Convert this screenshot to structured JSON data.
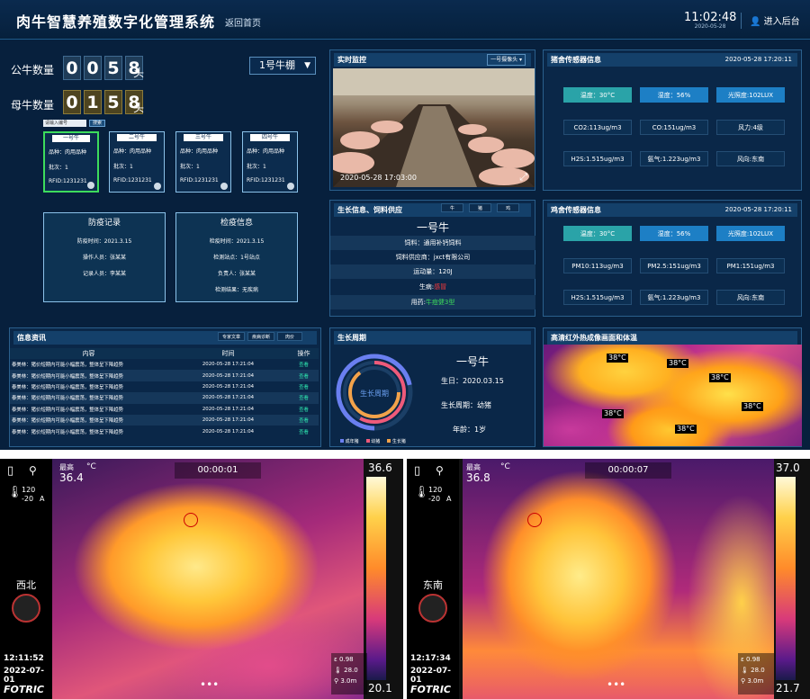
{
  "header": {
    "title": "肉牛智慧养殖数字化管理系统",
    "back": "返回首页",
    "time": "11:02:48",
    "date": "2020-05-28",
    "login": "进入后台"
  },
  "counts": {
    "bull_label": "公牛数量",
    "bull_digits": [
      "0",
      "0",
      "5",
      "8"
    ],
    "cow_label": "母牛数量",
    "cow_digits": [
      "0",
      "1",
      "5",
      "8"
    ],
    "unit": "头",
    "shed": "1号牛棚"
  },
  "search": {
    "placeholder": "请输入编号",
    "button": "搜索"
  },
  "cattle": [
    {
      "name": "一号牛",
      "breed": "品种：肉用品种",
      "batch": "批次：1",
      "rfid": "RFID:1231231"
    },
    {
      "name": "二号牛",
      "breed": "品种：肉用品种",
      "batch": "批次：1",
      "rfid": "RFID:1231231"
    },
    {
      "name": "三号牛",
      "breed": "品种：肉用品种",
      "batch": "批次：1",
      "rfid": "RFID:1231231"
    },
    {
      "name": "四号牛",
      "breed": "品种：肉用品种",
      "batch": "批次：1",
      "rfid": "RFID:1231231"
    }
  ],
  "epidemic": {
    "title": "防疫记录",
    "time": "防疫时间：2021.3.15",
    "operator": "操作人员：张某某",
    "recorder": "记录人员：李某某"
  },
  "quarantine": {
    "title": "检疫信息",
    "time": "检疫时间：2021.3.15",
    "site": "检测站点：1号站点",
    "lead": "负责人：张某某",
    "result": "检测结果：无疾病"
  },
  "monitor": {
    "title": "实时监控",
    "camera": "一号摄像头",
    "timestamp": "2020-05-28  17:03:00"
  },
  "pig_sensors": {
    "title": "猪舍传感器信息",
    "time": "2020-05-28 17:20:11",
    "items": [
      "温度：30°C",
      "湿度：56%",
      "光照度:102LUX",
      "CO2:113ug/m3",
      "CO:151ug/m3",
      "风力:4级",
      "H2S:1.515ug/m3",
      "氨气:1.223ug/m3",
      "风向:东南"
    ]
  },
  "chicken_sensors": {
    "title": "鸡舍传感器信息",
    "time": "2020-05-28 17:20:11",
    "items": [
      "温度：30°C",
      "湿度：56%",
      "光照度:102LUX",
      "PM10:113ug/m3",
      "PM2.5:151ug/m3",
      "PM1:151ug/m3",
      "H2S:1.515ug/m3",
      "氨气:1.223ug/m3",
      "风向:东南"
    ]
  },
  "growth": {
    "title": "生长信息、饲料供应",
    "tabs": [
      "牛",
      "猪",
      "鸡"
    ],
    "name": "一号牛",
    "feed": "饲料：通用补钙饲料",
    "supplier": "饲料供应商：jxct有限公司",
    "exercise": "运动量：120J",
    "disease_label": "生病:",
    "disease": "感冒",
    "med_label": "用药:",
    "med": "牛痘健3型"
  },
  "news": {
    "title": "信息资讯",
    "tabs": [
      "专家文章",
      "疾病诊断",
      "肉价"
    ],
    "cols": [
      "内容",
      "时间",
      "操作"
    ],
    "rows": [
      [
        "泰美林：猪价短期内可能小幅震荡，整体呈下降趋势",
        "2020-05-28 17:21:04",
        "查看"
      ],
      [
        "泰美林：猪价短期内可能小幅震荡，整体呈下降趋势",
        "2020-05-28 17:21:04",
        "查看"
      ],
      [
        "泰美林：猪价短期内可能小幅震荡，整体呈下降趋势",
        "2020-05-28 17:21:04",
        "查看"
      ],
      [
        "泰美林：猪价短期内可能小幅震荡，整体呈下降趋势",
        "2020-05-28 17:21:04",
        "查看"
      ],
      [
        "泰美林：猪价短期内可能小幅震荡，整体呈下降趋势",
        "2020-05-28 17:21:04",
        "查看"
      ],
      [
        "泰美林：猪价短期内可能小幅震荡，整体呈下降趋势",
        "2020-05-28 17:21:04",
        "查看"
      ],
      [
        "泰美林：猪价短期内可能小幅震荡，整体呈下降趋势",
        "2020-05-28 17:21:04",
        "查看"
      ]
    ]
  },
  "cycle": {
    "title": "生长周期",
    "center": "生长周期",
    "name": "一号牛",
    "birthday": "生日：2020.03.15",
    "stage": "生长周期：幼猪",
    "age": "年龄：1岁",
    "legend": [
      "成年猪",
      "幼猪",
      "生长猪"
    ],
    "colors": [
      "#6a7ff0",
      "#ef5a7a",
      "#f2a24a"
    ]
  },
  "infrared": {
    "title": "高清红外热成像画面和体温",
    "temps": [
      "38°C",
      "38°C",
      "38°C",
      "38°C",
      "38°C",
      "38°C"
    ]
  },
  "thermal": [
    {
      "max_label": "最高",
      "max": "36.4",
      "unit": "°C",
      "timer": "00:00:01",
      "scale_top": "36.6",
      "scale_bottom": "20.1",
      "range_hi": "120",
      "range_lo": "-20",
      "mode": "A",
      "dir": "西北",
      "time": "12:11:52",
      "date": "2022-07-01",
      "brand": "FOTRIC",
      "eps": "0.98",
      "amb": "28.0",
      "dist": "3.0m"
    },
    {
      "max_label": "最高",
      "max": "36.8",
      "unit": "°C",
      "timer": "00:00:07",
      "scale_top": "37.0",
      "scale_bottom": "21.7",
      "range_hi": "120",
      "range_lo": "-20",
      "mode": "A",
      "dir": "东南",
      "time": "12:17:34",
      "date": "2022-07-01",
      "brand": "FOTRIC",
      "eps": "0.98",
      "amb": "28.0",
      "dist": "3.0m"
    }
  ]
}
